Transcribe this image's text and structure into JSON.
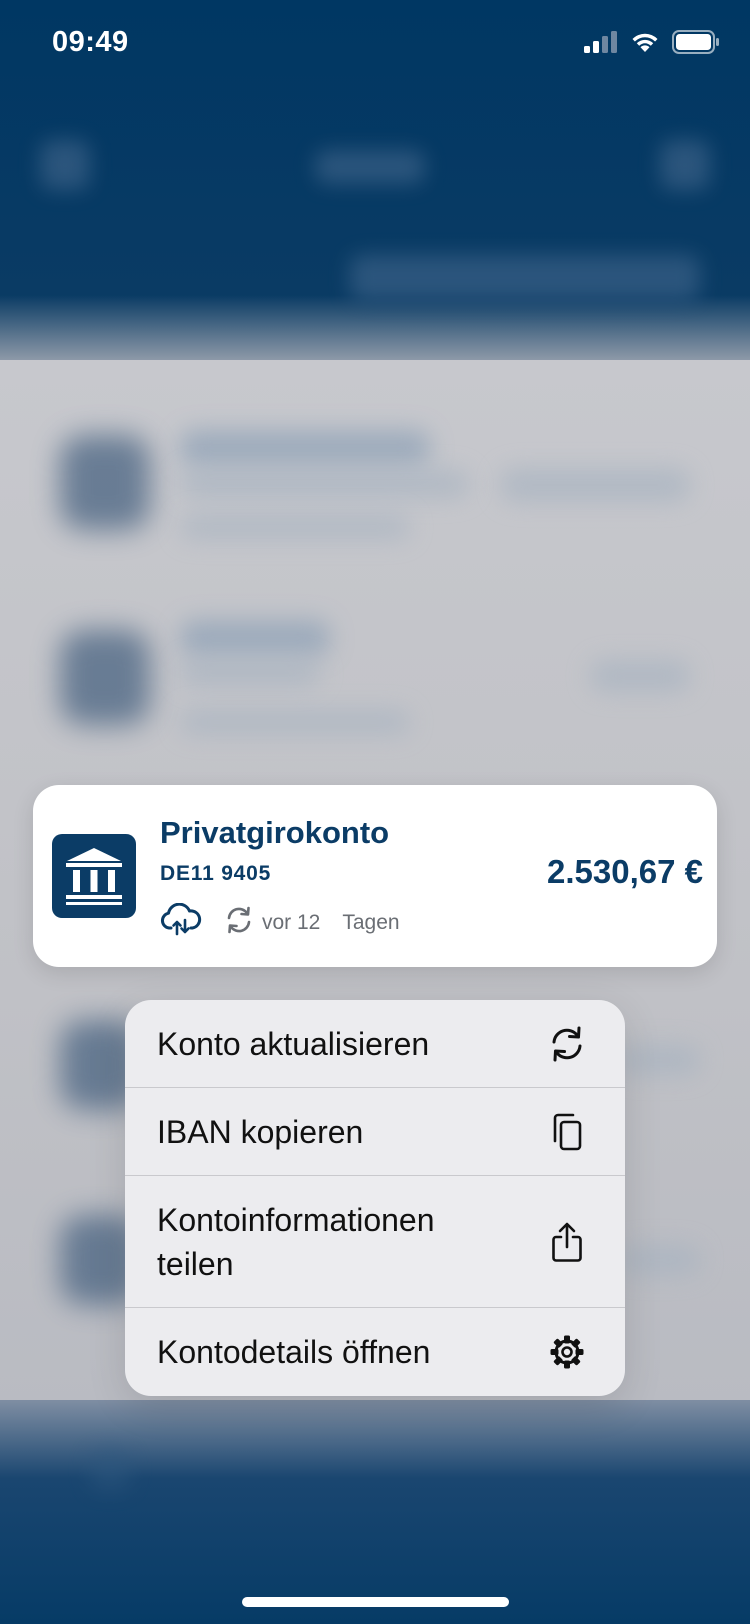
{
  "status_bar": {
    "time": "09:49",
    "icons": [
      "signal-icon",
      "wifi-icon",
      "battery-icon"
    ]
  },
  "account_card": {
    "name": "Privatgirokonto",
    "iban": "DE11 9405",
    "amount": "2.530,67 €",
    "sync_text": "vor 12",
    "sync_unit": "Tagen",
    "icons": [
      "bank-icon",
      "cloud-sync-icon",
      "refresh-icon"
    ]
  },
  "context_menu": {
    "items": [
      {
        "label": "Konto aktualisieren",
        "icon": "refresh-icon"
      },
      {
        "label": "IBAN kopieren",
        "icon": "copy-icon"
      },
      {
        "label": "Kontoinformationen teilen",
        "icon": "share-icon"
      },
      {
        "label": "Kontodetails öffnen",
        "icon": "gear-icon"
      }
    ]
  },
  "colors": {
    "brand_navy": "#0b3c66",
    "card_background": "#ffffff",
    "menu_background": "#ececef",
    "status_text": "#6a6e74"
  }
}
